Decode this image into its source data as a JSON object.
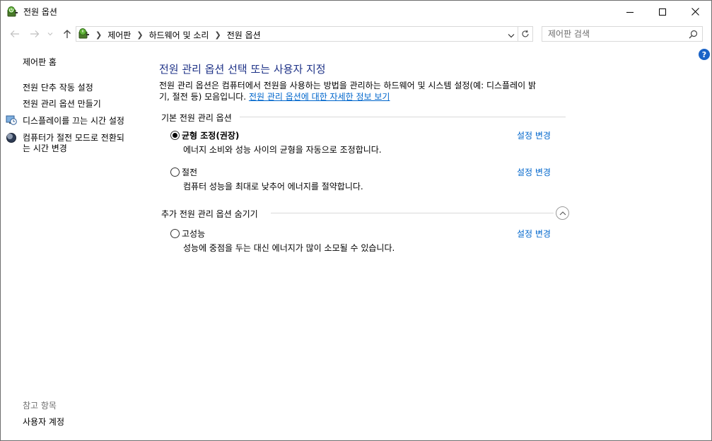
{
  "window": {
    "title": "전원 옵션"
  },
  "address_bar": {
    "crumbs": [
      "제어판",
      "하드웨어 및 소리",
      "전원 옵션"
    ]
  },
  "search": {
    "placeholder": "제어판 검색"
  },
  "left_nav": {
    "home": "제어판 홈",
    "items": [
      "전원 단추 작동 설정",
      "전원 관리 옵션 만들기",
      "디스플레이를 끄는 시간 설정",
      "컴퓨터가 절전 모드로 전환되",
      "는 시간 변경"
    ],
    "see_also": "참고 항목",
    "see_also_items": [
      "사용자 계정"
    ]
  },
  "main": {
    "heading": "전원 관리 옵션 선택 또는 사용자 지정",
    "desc_line1": "전원 관리 옵션은 컴퓨터에서 전원을 사용하는 방법을 관리하는 하드웨어 및 시스템 설정(예: 디스플레이 밝",
    "desc_line2": "기, 절전 등) 모음입니다. ",
    "desc_link": "전원 관리 옵션에 대한 자세한 정보 보기",
    "group_basic": "기본 전원 관리 옵션",
    "group_additional": "추가 전원 관리 옵션 숨기기",
    "plans": [
      {
        "name": "균형 조정(권장)",
        "desc": "에너지 소비와 성능 사이의 균형을 자동으로 조정합니다.",
        "selected": true,
        "change": "설정 변경"
      },
      {
        "name": "절전",
        "desc": "컴퓨터 성능을 최대로 낮추어 에너지를 절약합니다.",
        "selected": false,
        "change": "설정 변경"
      },
      {
        "name": "고성능",
        "desc": "성능에 중점을 두는 대신 에너지가 많이 소모될 수 있습니다.",
        "selected": false,
        "change": "설정 변경"
      }
    ]
  },
  "icons": {
    "app": "power-options-icon",
    "help": "help-icon"
  },
  "colors": {
    "heading": "#1e3287",
    "link": "#0066cc",
    "help_badge": "#1a63c7"
  }
}
